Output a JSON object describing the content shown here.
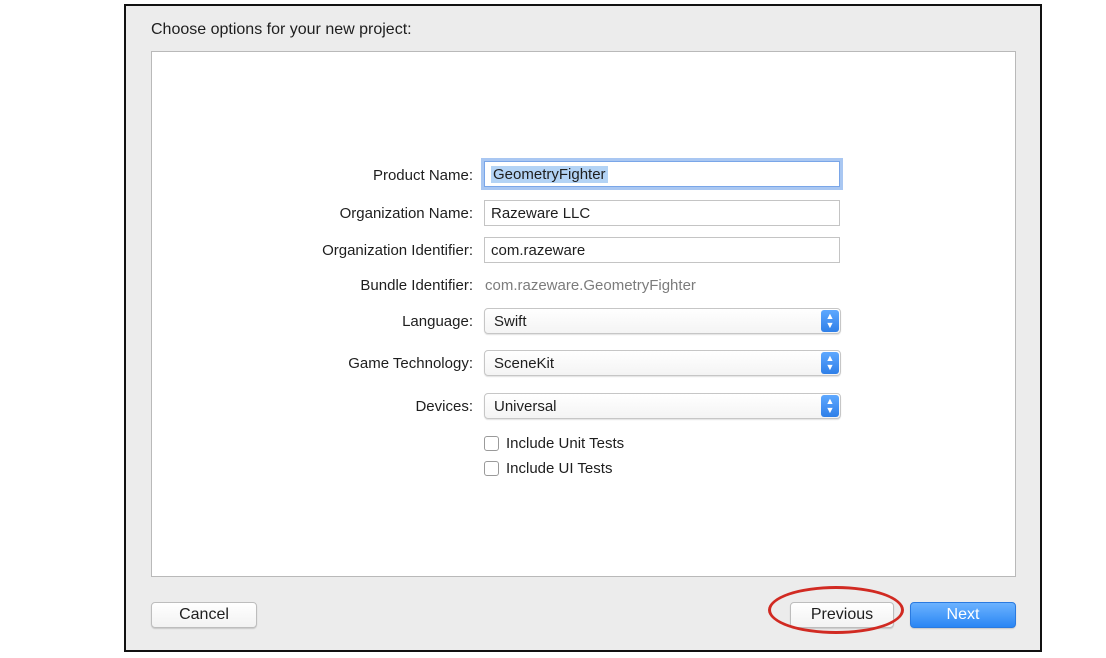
{
  "dialog": {
    "title": "Choose options for your new project:"
  },
  "form": {
    "product_name": {
      "label": "Product Name:",
      "value": "GeometryFighter"
    },
    "organization_name": {
      "label": "Organization Name:",
      "value": "Razeware LLC"
    },
    "organization_identifier": {
      "label": "Organization Identifier:",
      "value": "com.razeware"
    },
    "bundle_identifier": {
      "label": "Bundle Identifier:",
      "value": "com.razeware.GeometryFighter"
    },
    "language": {
      "label": "Language:",
      "value": "Swift"
    },
    "game_technology": {
      "label": "Game Technology:",
      "value": "SceneKit"
    },
    "devices": {
      "label": "Devices:",
      "value": "Universal"
    },
    "unit_tests": {
      "label": "Include Unit Tests",
      "checked": false
    },
    "ui_tests": {
      "label": "Include UI Tests",
      "checked": false
    }
  },
  "buttons": {
    "cancel": "Cancel",
    "previous": "Previous",
    "next": "Next"
  },
  "colors": {
    "accent_blue": "#2a86f4",
    "highlight_ring": "#d12a22",
    "selection": "#b3d3f5"
  },
  "icons": {
    "popup_arrows": "chevron-up-down-icon"
  }
}
